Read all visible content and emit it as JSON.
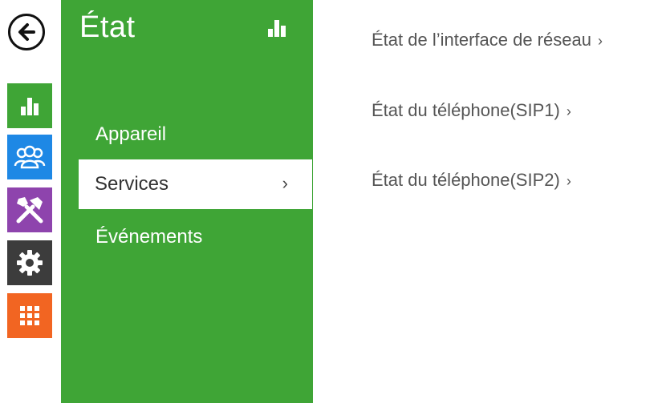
{
  "colors": {
    "panel": "#3fa536",
    "status_icon_bg": "#3fa536",
    "directory_icon_bg": "#1e88e5",
    "hardware_icon_bg": "#8e44ad",
    "services_icon_bg": "#3c3c3c",
    "system_icon_bg": "#f26522"
  },
  "back": {
    "icon": "back-arrow-icon"
  },
  "rail": [
    {
      "icon": "status-chart-icon"
    },
    {
      "icon": "directory-users-icon"
    },
    {
      "icon": "hardware-tools-icon"
    },
    {
      "icon": "services-gear-icon"
    },
    {
      "icon": "system-grid-icon"
    }
  ],
  "panel": {
    "title": "État",
    "title_icon": "status-chart-icon",
    "menu": [
      {
        "label": "Appareil"
      },
      {
        "label": "Services",
        "chevron": "›",
        "active": true
      },
      {
        "label": "Événements"
      }
    ]
  },
  "links": [
    {
      "label": "État de l’interface de réseau",
      "chevron": "›"
    },
    {
      "label": "État du téléphone(SIP1)",
      "chevron": "›"
    },
    {
      "label": "État du téléphone(SIP2)",
      "chevron": "›"
    }
  ]
}
